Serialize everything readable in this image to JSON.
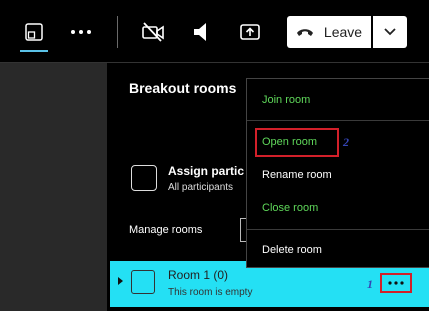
{
  "toolbar": {
    "leave_label": "Leave"
  },
  "panel": {
    "title": "Breakout rooms",
    "assign_title": "Assign partic",
    "assign_subtitle": "All participants",
    "manage_label": "Manage rooms"
  },
  "room": {
    "name": "Room 1 (0)",
    "status": "This room is empty"
  },
  "menu": {
    "join": "Join room",
    "open": "Open room",
    "rename": "Rename room",
    "close": "Close room",
    "delete": "Delete room"
  },
  "annotations": {
    "step1": "1",
    "step2": "2"
  },
  "colors": {
    "room_highlight": "#24e0f4",
    "menu_green": "#5fd75a",
    "annotation_red": "#d3202a",
    "annotation_blue": "#3545b5"
  }
}
